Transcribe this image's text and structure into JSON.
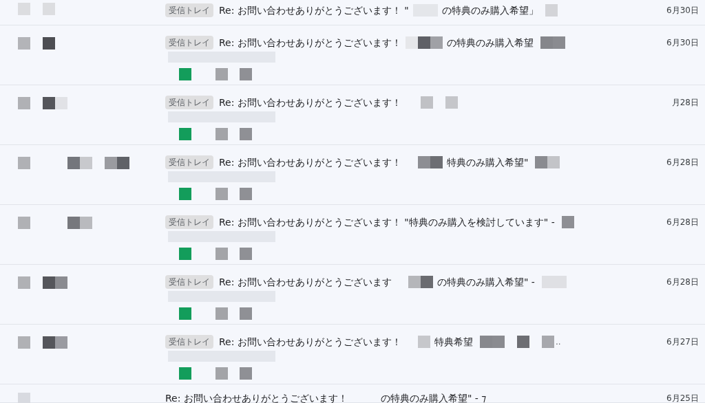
{
  "rows": [
    {
      "kind": "compact",
      "label": "受信トレイ",
      "subject": "Re: お問い合わせありがとうございます！ \"",
      "snippet": "の特典のみ購入希望」",
      "date": "6月30日"
    },
    {
      "kind": "full",
      "label": "受信トレイ",
      "subject": "Re: お問い合わせありがとうございます！",
      "snippet": "の特典のみ購入希望",
      "date": "6月30日"
    },
    {
      "kind": "full",
      "label": "受信トレイ",
      "subject": "Re: お問い合わせありがとうございます！",
      "date": "月28日"
    },
    {
      "kind": "full",
      "label": "受信トレイ",
      "subject": "Re: お問い合わせありがとうございます！",
      "snippet": "特典のみ購入希望\"",
      "date": "6月28日"
    },
    {
      "kind": "full",
      "label": "受信トレイ",
      "subject": "Re: お問い合わせありがとうございます！ \"特典のみ購入を検討しています\" -",
      "date": "6月28日"
    },
    {
      "kind": "full",
      "label": "受信トレイ",
      "subject": "Re: お問い合わせありがとうございます",
      "snippet": "の特典のみ購入希望\" -",
      "date": "6月28日"
    },
    {
      "kind": "full",
      "label": "受信トレイ",
      "subject": "Re: お問い合わせありがとうございます！",
      "snippet": "特典希望",
      "trail": "..",
      "date": "6月27日"
    },
    {
      "kind": "compact",
      "subject": "Re: お問い合わせありがとうございます！",
      "snippet": "の特典のみ購入希望\" - ⁊",
      "date": "6月25日"
    }
  ]
}
